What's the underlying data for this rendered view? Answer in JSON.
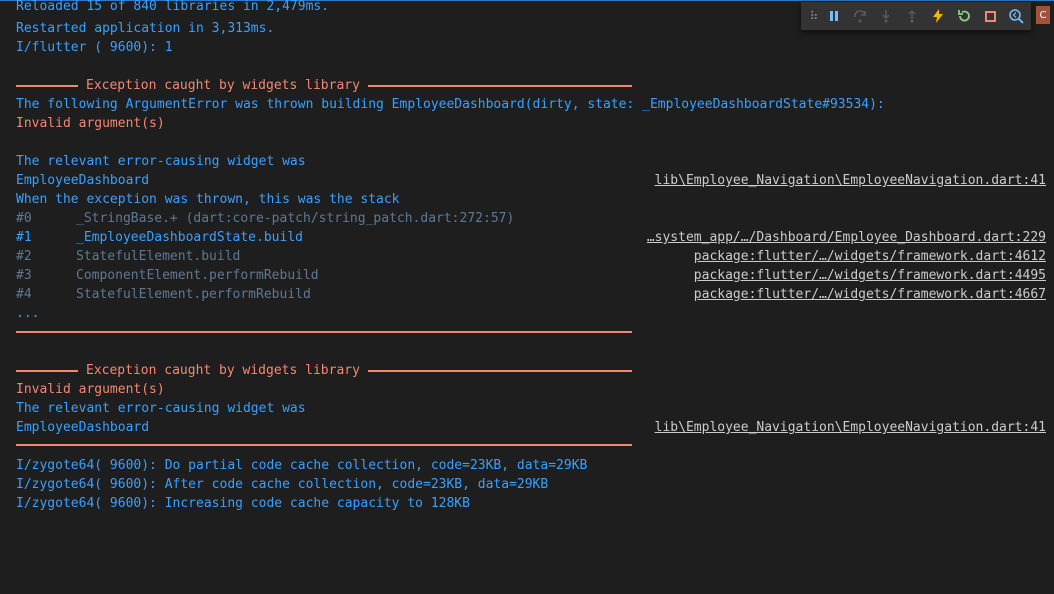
{
  "log": {
    "l1": "Reloaded 15 of 840 libraries in 2,479ms.",
    "l2": "Restarted application in 3,313ms.",
    "l3": "I/flutter ( 9600): 1",
    "exception_header": "Exception caught by widgets library",
    "arg_error": "The following ArgumentError was thrown building EmployeeDashboard(dirty, state: _EmployeeDashboardState#93534):",
    "invalid_argument": "Invalid argument(s)",
    "relevant_widget": "The relevant error-causing widget was",
    "widget_name": "EmployeeDashboard",
    "widget_link": "lib\\Employee_Navigation\\EmployeeNavigation.dart:41",
    "stack_intro": "When the exception was thrown, this was the stack",
    "ellipsis": "...",
    "zygote1": "I/zygote64( 9600): Do partial code cache collection, code=23KB, data=29KB",
    "zygote2": "I/zygote64( 9600): After code cache collection, code=23KB, data=29KB",
    "zygote3": "I/zygote64( 9600): Increasing code cache capacity to 128KB"
  },
  "stack": [
    {
      "num": "#0",
      "frame": "_StringBase.+ (dart:core-patch/string_patch.dart:272:57)",
      "link": ""
    },
    {
      "num": "#1",
      "frame": "_EmployeeDashboardState.build",
      "link": "…system_app/…/Dashboard/Employee_Dashboard.dart:229"
    },
    {
      "num": "#2",
      "frame": "StatefulElement.build",
      "link": "package:flutter/…/widgets/framework.dart:4612"
    },
    {
      "num": "#3",
      "frame": "ComponentElement.performRebuild",
      "link": "package:flutter/…/widgets/framework.dart:4495"
    },
    {
      "num": "#4",
      "frame": "StatefulElement.performRebuild",
      "link": "package:flutter/…/widgets/framework.dart:4667"
    }
  ],
  "toolbar": {
    "grip": "⠷",
    "pause_icon": "pause-icon",
    "step_over_icon": "step-over-icon",
    "step_into_icon": "step-into-icon",
    "step_out_icon": "step-out-icon",
    "hot_reload_icon": "lightning-icon",
    "restart_icon": "restart-icon",
    "stop_icon": "stop-icon",
    "inspect_icon": "widget-inspector-icon"
  },
  "avatar_letter": "C",
  "colors": {
    "background": "#1e1e1e",
    "log_blue": "#3aa0ff",
    "error_orange": "#f48771",
    "muted_gray": "#5f7891",
    "link_text": "#cccccc"
  }
}
